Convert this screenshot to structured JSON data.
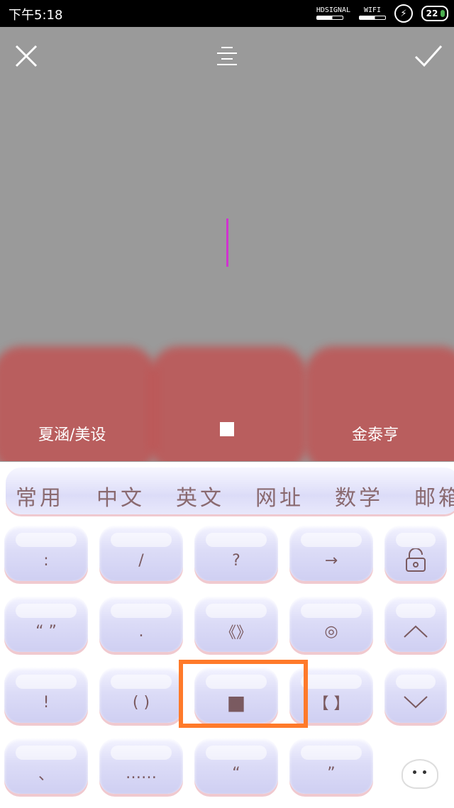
{
  "status_bar": {
    "time": "下午5:18",
    "signal_label": "HDSIGNAL",
    "wifi_label": "WIFI",
    "battery_level": "22"
  },
  "editor": {
    "bottom_left_label": "夏涵/美设",
    "bottom_right_label": "金泰亨",
    "icons": {
      "close": "close-icon",
      "align": "align-center-icon",
      "confirm": "check-icon"
    },
    "cursor_color": "#d033d0"
  },
  "keyboard": {
    "tabs": [
      "常用",
      "中文",
      "英文",
      "网址",
      "数学",
      "邮箱"
    ],
    "rows": [
      [
        ":",
        "/",
        "?",
        "→",
        "lock-icon"
      ],
      [
        "“ ”",
        ".",
        "《》",
        "◎",
        "up-arrow-icon"
      ],
      [
        "!",
        "( )",
        "■",
        "【 】",
        "down-arrow-icon"
      ],
      [
        "、",
        "……",
        "“",
        "”",
        "mascot-icon"
      ]
    ],
    "highlight_color": "#ff7a2a"
  }
}
